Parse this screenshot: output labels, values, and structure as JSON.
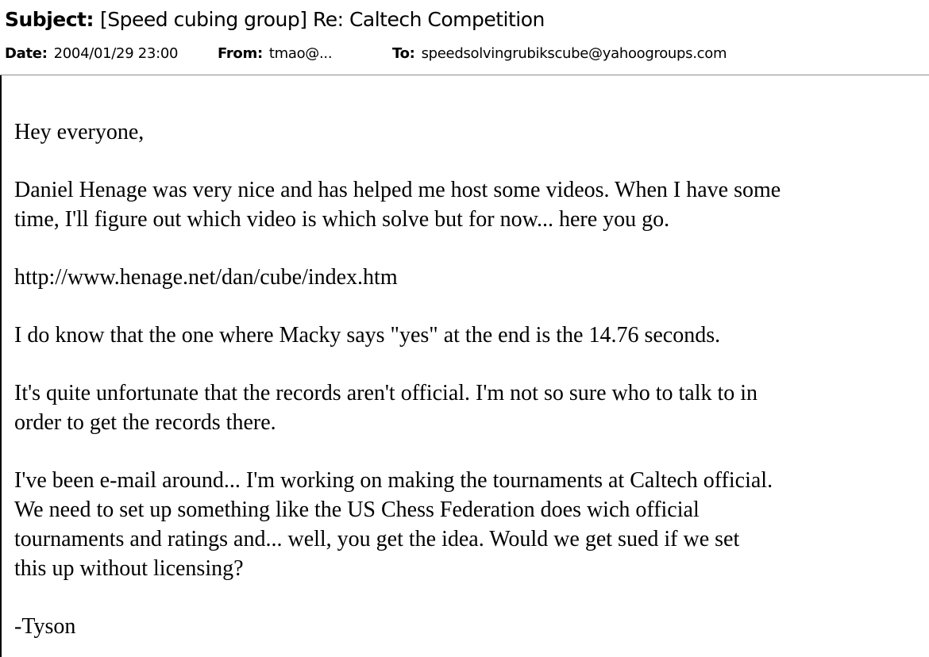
{
  "header": {
    "subject_label": "Subject:",
    "subject_value": "[Speed cubing group] Re: Caltech Competition",
    "date_label": "Date:",
    "date_value": "2004/01/29 23:00",
    "from_label": "From:",
    "from_value": "tmao@...",
    "to_label": "To:",
    "to_value": "speedsolvingrubikscube@yahoogroups.com"
  },
  "message": {
    "greeting": "Hey everyone,",
    "paragraph_1": "Daniel Henage was very nice and has helped me host some videos. When I have some\ntime, I'll figure out which video is which solve but for now... here you go.",
    "link": "http://www.henage.net/dan/cube/index.htm",
    "paragraph_2": "I do know that the one where Macky says \"yes\" at the end is the 14.76 seconds.",
    "paragraph_3": "It's quite unfortunate that the records aren't official. I'm not so sure who to talk to in\norder to get the records there.",
    "paragraph_4": "I've been e-mail around... I'm working on making the tournaments at Caltech official.\nWe need to set up something like the US Chess Federation does wich official\ntournaments and ratings and... well, you get the idea. Would we get sued if we set\nthis up without licensing?",
    "signature": "-Tyson"
  },
  "colors": {
    "background": "#ffffff",
    "text": "#000000",
    "divider": "#8c8c8c"
  }
}
